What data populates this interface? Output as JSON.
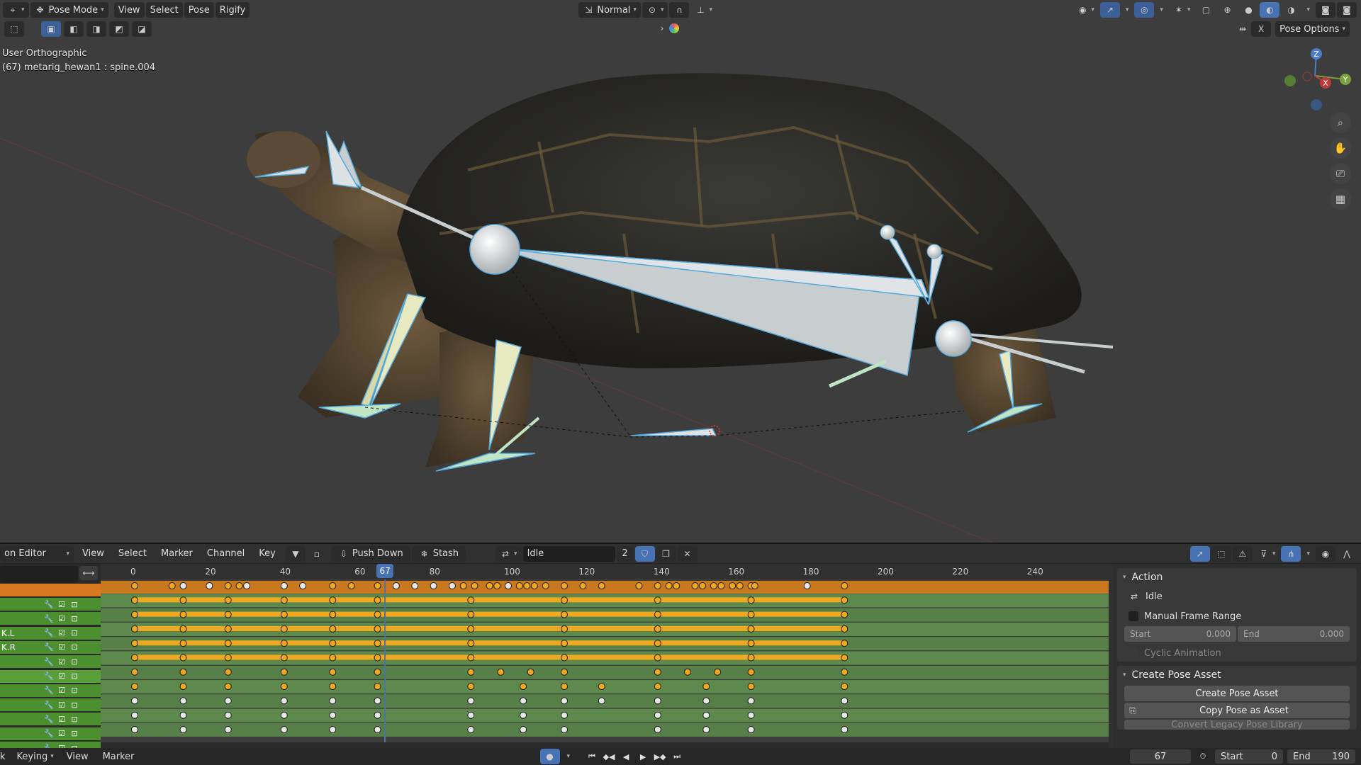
{
  "viewport": {
    "mode": "Pose Mode",
    "menus": [
      "View",
      "Select",
      "Pose",
      "Rigify"
    ],
    "transform_orientation": "Normal",
    "pose_options": "Pose Options",
    "view_name": "User Orthographic",
    "active_object": "(67) metarig_hewan1 : spine.004",
    "gizmo_axes": [
      "Z",
      "Y",
      "X"
    ],
    "nav_icons": [
      "zoom-icon",
      "hand-pan-icon",
      "camera-icon",
      "grid-icon"
    ]
  },
  "action_editor": {
    "editor_name": "on Editor",
    "menus": [
      "View",
      "Select",
      "Marker",
      "Channel",
      "Key"
    ],
    "push_down": "Push Down",
    "stash": "Stash",
    "action_name": "Idle",
    "users": "2",
    "current_frame": "67",
    "ruler_ticks": [
      "0",
      "20",
      "40",
      "60",
      "80",
      "100",
      "120",
      "140",
      "160",
      "180",
      "200",
      "220",
      "240"
    ],
    "channels": [
      "",
      "",
      "K.L",
      "K.R",
      "",
      "",
      "",
      "",
      "",
      "",
      ""
    ],
    "side_panel": {
      "action_header": "Action",
      "action_name": "Idle",
      "manual_frame_range": "Manual Frame Range",
      "start_label": "Start",
      "start_value": "0.000",
      "end_label": "End",
      "end_value": "0.000",
      "cyclic": "Cyclic Animation",
      "create_pose_header": "Create Pose Asset",
      "create_pose_btn": "Create Pose Asset",
      "copy_pose_btn": "Copy Pose as Asset",
      "convert_btn": "Convert Legacy Pose Library"
    }
  },
  "status_bar": {
    "left_cut": "k",
    "keying": "Keying",
    "menus": [
      "View",
      "Marker"
    ],
    "frame": "67",
    "start_label": "Start",
    "start_value": "0",
    "end_label": "End",
    "end_value": "190"
  },
  "colors": {
    "key_orange": "#f0a91e",
    "channel_green": "#4c8f2f",
    "timeline_green": "#5d8a4c",
    "active_blue": "#4772b3"
  }
}
